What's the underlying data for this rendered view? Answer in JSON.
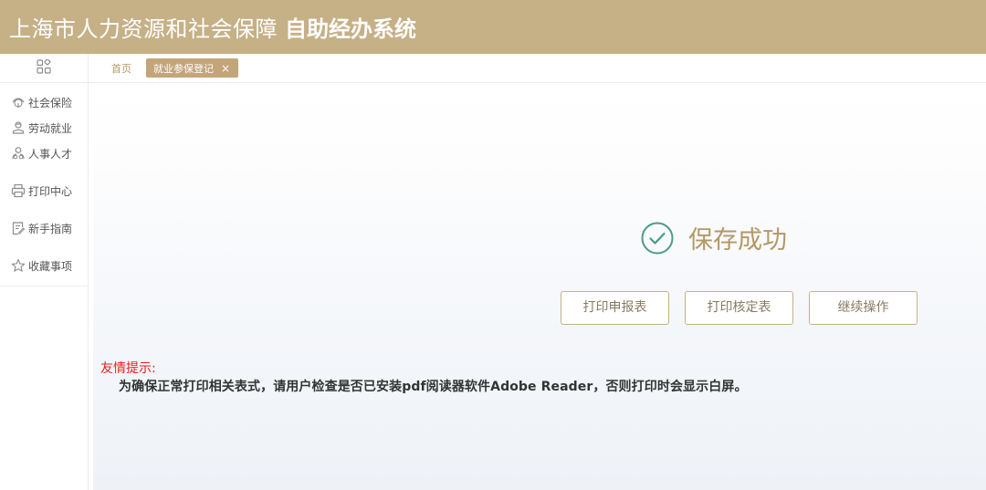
{
  "header": {
    "title": "上海市人力资源和社会保障",
    "subtitle": "自助经办系统",
    "background_color": "#c6b086"
  },
  "sidebar": {
    "top_icon": "grid-apps-icon",
    "items": [
      {
        "label": "社会保险",
        "icon": "umbrella-icon"
      },
      {
        "label": "劳动就业",
        "icon": "worker-icon"
      },
      {
        "label": "人事人才",
        "icon": "people-icon"
      },
      {
        "label": "打印中心",
        "icon": "printer-icon"
      },
      {
        "label": "新手指南",
        "icon": "guide-icon"
      },
      {
        "label": "收藏事项",
        "icon": "star-icon"
      }
    ]
  },
  "tabs": {
    "home": "首页",
    "active": "就业参保登记",
    "close_icon": "close-icon"
  },
  "main": {
    "success_icon": "check-circle-icon",
    "success_message": "保存成功",
    "buttons": {
      "print_declaration": "打印申报表",
      "print_verification": "打印核定表",
      "continue": "继续操作"
    },
    "tip": {
      "title": "友情提示:",
      "text": "为确保正常打印相关表式，请用户检查是否已安装pdf阅读器软件Adobe Reader，否则打印时会显示白屏。"
    },
    "accent_color": "#b49866",
    "tip_title_color": "#e02020"
  }
}
